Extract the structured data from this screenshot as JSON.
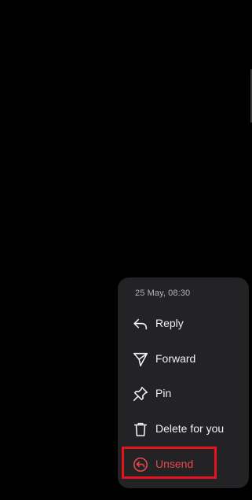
{
  "menu": {
    "timestamp": "25 May, 08:30",
    "items": [
      {
        "label": "Reply",
        "icon": "reply-icon"
      },
      {
        "label": "Forward",
        "icon": "send-icon"
      },
      {
        "label": "Pin",
        "icon": "pin-icon"
      },
      {
        "label": "Delete for you",
        "icon": "trash-icon"
      },
      {
        "label": "Unsend",
        "icon": "unsend-icon",
        "color": "#e8484c"
      }
    ]
  },
  "colors": {
    "background": "#000000",
    "menu_background": "#232326",
    "text": "#f1f1f3",
    "destructive": "#e8484c",
    "highlight": "#e3151c"
  }
}
